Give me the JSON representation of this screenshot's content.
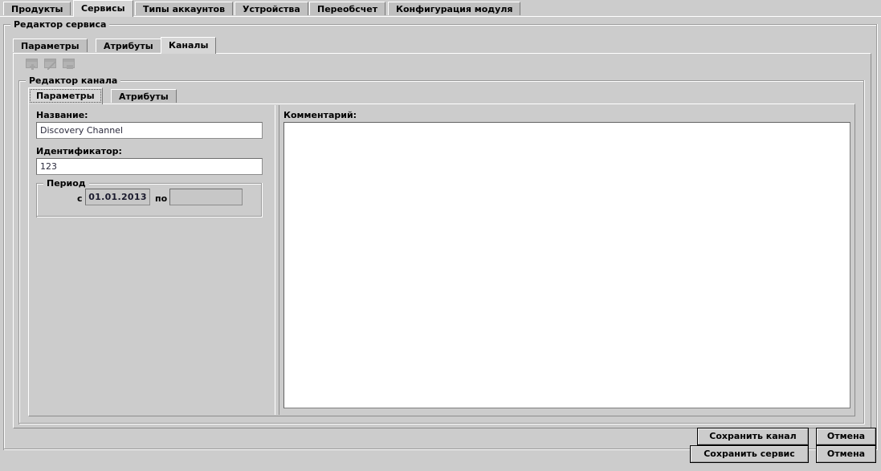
{
  "window": {
    "background": "#cccccc",
    "accent": "#d6d6d6"
  },
  "top_tabs": {
    "items": [
      {
        "label": "Продукты",
        "active": false
      },
      {
        "label": "Сервисы",
        "active": true
      },
      {
        "label": "Типы аккаунтов",
        "active": false
      },
      {
        "label": "Устройства",
        "active": false
      },
      {
        "label": "Переобсчет",
        "active": false
      },
      {
        "label": "Конфигурация модуля",
        "active": false
      }
    ]
  },
  "service_editor": {
    "title": "Редактор сервиса",
    "tabs": [
      {
        "label": "Параметры",
        "active": false
      },
      {
        "label": "Атрибуты",
        "active": false
      },
      {
        "label": "Каналы",
        "active": true
      }
    ]
  },
  "toolbar": {
    "buttons": [
      {
        "name": "add-channel-button",
        "icon": "add-window-icon",
        "enabled": false
      },
      {
        "name": "edit-channel-button",
        "icon": "edit-window-icon",
        "enabled": false
      },
      {
        "name": "delete-channel-button",
        "icon": "delete-window-icon",
        "enabled": false
      }
    ]
  },
  "channel_editor": {
    "title": "Редактор канала",
    "tabs": [
      {
        "label": "Параметры",
        "active": true
      },
      {
        "label": "Атрибуты",
        "active": false
      }
    ],
    "fields": {
      "name_label": "Название:",
      "name_value": "Discovery Channel",
      "id_label": "Идентификатор:",
      "id_value": "123",
      "comment_label": "Комментарий:",
      "comment_value": ""
    },
    "period": {
      "title": "Период",
      "from_label": "с",
      "from_value": "01.01.2013",
      "to_label": "по",
      "to_value": ""
    },
    "actions": {
      "save_label": "Сохранить канал",
      "cancel_label": "Отмена"
    }
  },
  "service_actions": {
    "save_label": "Сохранить сервис",
    "cancel_label": "Отмена"
  }
}
